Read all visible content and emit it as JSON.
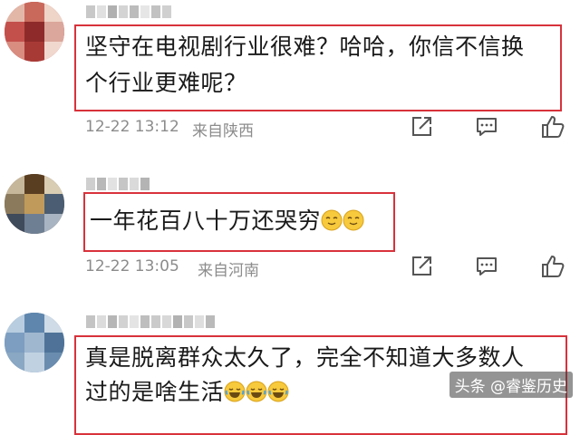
{
  "comments": [
    {
      "text_lines": [
        "坚守在电视剧行业很难？哈哈，你信不信换",
        "个行业更难呢？"
      ],
      "time": "12-22 13:12",
      "location": "来自陕西"
    },
    {
      "text_lines": [
        "一年花百八十万还哭穷"
      ],
      "time": "12-22 13:05",
      "location": "来自河南"
    },
    {
      "text_lines": [
        "真是脱离群众太久了，完全不知道大多数人",
        "过的是啥生活"
      ]
    }
  ],
  "icons": {
    "share": "share-icon",
    "reply": "comment-icon",
    "like": "thumbs-up-icon",
    "smile_emoji": "smile-emoji-icon",
    "laugh_emoji": "laugh-cry-emoji-icon"
  },
  "watermark": "头条 @睿鉴历史",
  "colors": {
    "highlight_border": "#d8323b",
    "meta": "#8c8c8c"
  }
}
